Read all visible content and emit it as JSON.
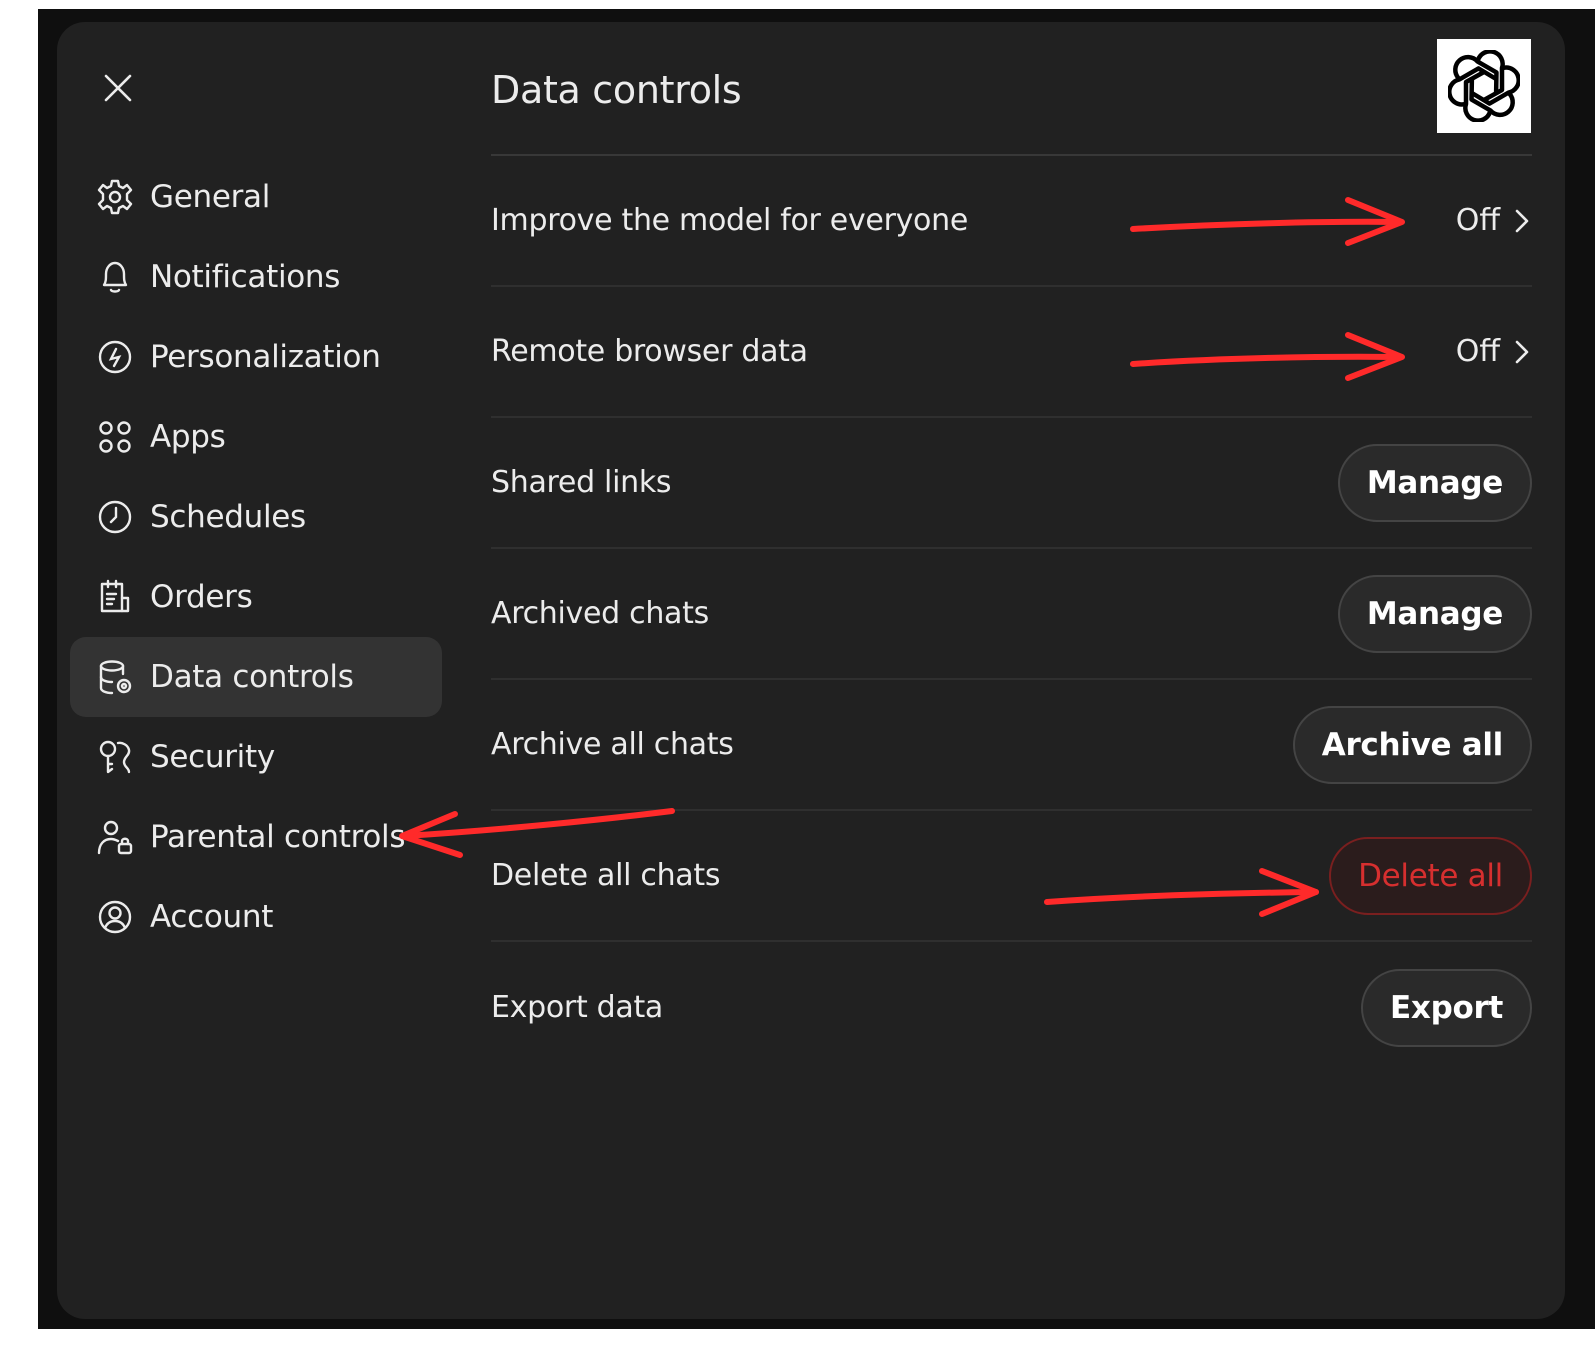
{
  "dialog": {
    "title": "Data controls",
    "close_icon": "close-icon",
    "logo_icon": "openai-logo-icon"
  },
  "sidebar": {
    "active_item": "Data controls",
    "items": [
      {
        "label": "General",
        "icon": "gear-icon"
      },
      {
        "label": "Notifications",
        "icon": "bell-icon"
      },
      {
        "label": "Personalization",
        "icon": "personalization-icon"
      },
      {
        "label": "Apps",
        "icon": "apps-grid-icon"
      },
      {
        "label": "Schedules",
        "icon": "clock-icon"
      },
      {
        "label": "Orders",
        "icon": "receipt-icon"
      },
      {
        "label": "Data controls",
        "icon": "database-gear-icon"
      },
      {
        "label": "Security",
        "icon": "shield-key-icon"
      },
      {
        "label": "Parental controls",
        "icon": "user-lock-icon"
      },
      {
        "label": "Account",
        "icon": "user-circle-icon"
      }
    ]
  },
  "settings": {
    "improve_model": {
      "label": "Improve the model for everyone",
      "value": "Off"
    },
    "remote_browser": {
      "label": "Remote browser data",
      "value": "Off"
    },
    "shared_links": {
      "label": "Shared links",
      "button": "Manage"
    },
    "archived_chats": {
      "label": "Archived chats",
      "button": "Manage"
    },
    "archive_all": {
      "label": "Archive all chats",
      "button": "Archive all"
    },
    "delete_all": {
      "label": "Delete all chats",
      "button": "Delete all"
    },
    "export_data": {
      "label": "Export data",
      "button": "Export"
    }
  },
  "colors": {
    "dialog_bg": "#212121",
    "active_item_bg": "#333333",
    "danger": "#d62f2f",
    "annotation_arrow": "#ff2a2a"
  }
}
